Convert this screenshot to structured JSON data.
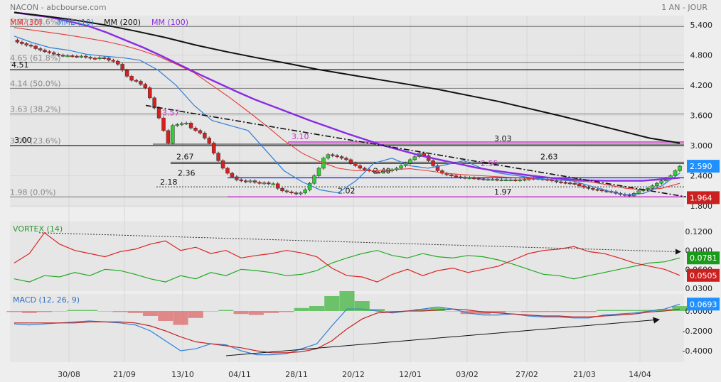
{
  "header": {
    "title": "NACON - abcbourse.com",
    "period": "1 AN - JOUR"
  },
  "legend": [
    {
      "label": "MM (30)",
      "color": "#e53935"
    },
    {
      "label": "MME (10)",
      "color": "#2f7fd6"
    },
    {
      "label": "MM (200)",
      "color": "#111111"
    },
    {
      "label": "MM (100)",
      "color": "#8a2be2"
    }
  ],
  "colors": {
    "background": "#eeeeee",
    "candle_up": "#33cc33",
    "candle_down": "#d62020",
    "fib_line": "#777777",
    "magenta": "#cc33cc",
    "blue_level": "#2b3fd6",
    "price_badge": "#1e90ff",
    "vortex_plus": "#22aa22",
    "vortex_minus": "#dd2222",
    "macd_line": "#2f7fd6",
    "signal_line": "#c62020",
    "hist_pos": "#55bb55",
    "hist_neg": "#dd7777"
  },
  "fibonacci": [
    {
      "label": "5.37 (78.6%)",
      "value": 5.37
    },
    {
      "label": "4.65 (61.8%)",
      "value": 4.65
    },
    {
      "label": "4.14 (50.0%)",
      "value": 4.14
    },
    {
      "label": "3.63 (38.2%)",
      "value": 3.63
    },
    {
      "label": "3.00 (23.6%)",
      "value": 3.0
    },
    {
      "label": "1.98 (0.0%)",
      "value": 1.98
    }
  ],
  "level_labels": [
    "4.51",
    "3.00",
    "3.10",
    "3.03",
    "2.67",
    "2.63",
    "2.36",
    "2.18",
    "2.40",
    "2.55",
    "2.02",
    "1.97",
    "3.57"
  ],
  "chart_data": [
    {
      "type": "candlestick",
      "title": "NACON",
      "x_tick_labels": [
        "30/08",
        "21/09",
        "13/10",
        "04/11",
        "28/11",
        "20/12",
        "12/01",
        "03/02",
        "27/02",
        "21/03",
        "14/04"
      ],
      "y_tick_labels": [
        "5.400",
        "4.800",
        "4.200",
        "3.600",
        "3.000",
        "2.400",
        "1.800"
      ],
      "ylim": [
        1.8,
        5.7
      ],
      "last_price": "2.590",
      "support_badge": "1.964",
      "closes": [
        5.1,
        5.06,
        5.03,
        5.0,
        4.98,
        4.93,
        4.9,
        4.87,
        4.85,
        4.82,
        4.8,
        4.79,
        4.79,
        4.78,
        4.77,
        4.78,
        4.76,
        4.74,
        4.73,
        4.75,
        4.74,
        4.7,
        4.68,
        4.62,
        4.5,
        4.38,
        4.3,
        4.28,
        4.22,
        4.15,
        3.95,
        3.75,
        3.55,
        3.3,
        3.05,
        3.4,
        3.42,
        3.44,
        3.45,
        3.35,
        3.3,
        3.25,
        3.15,
        3.05,
        2.85,
        2.7,
        2.55,
        2.45,
        2.38,
        2.32,
        2.3,
        2.28,
        2.3,
        2.27,
        2.25,
        2.26,
        2.24,
        2.24,
        2.15,
        2.1,
        2.08,
        2.06,
        2.04,
        2.06,
        2.12,
        2.25,
        2.4,
        2.55,
        2.75,
        2.82,
        2.8,
        2.78,
        2.75,
        2.72,
        2.65,
        2.6,
        2.55,
        2.52,
        2.5,
        2.48,
        2.47,
        2.48,
        2.5,
        2.52,
        2.55,
        2.6,
        2.65,
        2.72,
        2.78,
        2.85,
        2.8,
        2.7,
        2.6,
        2.5,
        2.45,
        2.42,
        2.4,
        2.38,
        2.37,
        2.36,
        2.36,
        2.35,
        2.34,
        2.33,
        2.33,
        2.33,
        2.32,
        2.32,
        2.32,
        2.32,
        2.31,
        2.32,
        2.33,
        2.34,
        2.35,
        2.34,
        2.33,
        2.32,
        2.3,
        2.28,
        2.27,
        2.26,
        2.25,
        2.24,
        2.2,
        2.17,
        2.15,
        2.13,
        2.12,
        2.1,
        2.09,
        2.08,
        2.05,
        2.03,
        2.02,
        2.0,
        2.05,
        2.1,
        2.12,
        2.15,
        2.2,
        2.25,
        2.3,
        2.35,
        2.4,
        2.5,
        2.59
      ],
      "series": [
        {
          "name": "MM (30)",
          "values": [
            5.35,
            5.3,
            5.25,
            5.2,
            5.14,
            5.08,
            5.0,
            4.9,
            4.78,
            4.62,
            4.45,
            4.2,
            3.95,
            3.68,
            3.4,
            3.1,
            2.85,
            2.68,
            2.55,
            2.5,
            2.5,
            2.52,
            2.54,
            2.5,
            2.45,
            2.42,
            2.4,
            2.38,
            2.36,
            2.34,
            2.32,
            2.3,
            2.28,
            2.22,
            2.15,
            2.12,
            2.15,
            2.25
          ]
        },
        {
          "name": "MME (10)",
          "values": [
            5.18,
            5.05,
            4.95,
            4.9,
            4.82,
            4.78,
            4.75,
            4.7,
            4.5,
            4.2,
            3.8,
            3.5,
            3.4,
            3.3,
            2.9,
            2.5,
            2.28,
            2.12,
            2.06,
            2.3,
            2.65,
            2.75,
            2.6,
            2.55,
            2.62,
            2.7,
            2.55,
            2.45,
            2.4,
            2.35,
            2.32,
            2.3,
            2.2,
            2.1,
            2.02,
            2.05,
            2.2,
            2.45
          ]
        },
        {
          "name": "MM (100)",
          "values": [
            5.65,
            5.6,
            5.55,
            5.47,
            5.38,
            5.25,
            5.1,
            4.95,
            4.78,
            4.6,
            4.42,
            4.25,
            4.08,
            3.92,
            3.78,
            3.64,
            3.5,
            3.37,
            3.24,
            3.12,
            3.0,
            2.9,
            2.8,
            2.72,
            2.64,
            2.56,
            2.5,
            2.45,
            2.4,
            2.36,
            2.33,
            2.31,
            2.3,
            2.3,
            2.3,
            2.33,
            2.36
          ]
        },
        {
          "name": "MM (200)",
          "values": [
            5.65,
            5.58,
            5.5,
            5.4,
            5.28,
            5.15,
            5.0,
            4.87,
            4.75,
            4.64,
            4.52,
            4.42,
            4.32,
            4.22,
            4.12,
            4.0,
            3.88,
            3.74,
            3.6,
            3.45,
            3.3,
            3.15,
            3.05
          ]
        }
      ]
    },
    {
      "type": "line",
      "title": "VORTEX (14)",
      "y_tick_labels": [
        "0.1200",
        "0.0900",
        "0.0600",
        "0.0300"
      ],
      "ylim": [
        0.03,
        0.12
      ],
      "badges": [
        "0.0781",
        "0.0505"
      ],
      "series": [
        {
          "name": "VI+",
          "values": [
            0.045,
            0.04,
            0.05,
            0.048,
            0.055,
            0.05,
            0.06,
            0.058,
            0.052,
            0.045,
            0.04,
            0.05,
            0.045,
            0.055,
            0.05,
            0.06,
            0.058,
            0.055,
            0.05,
            0.052,
            0.058,
            0.07,
            0.078,
            0.085,
            0.09,
            0.082,
            0.078,
            0.085,
            0.08,
            0.078,
            0.082,
            0.08,
            0.075,
            0.068,
            0.06,
            0.052,
            0.05,
            0.045,
            0.05,
            0.055,
            0.06,
            0.065,
            0.07,
            0.072,
            0.078
          ]
        },
        {
          "name": "VI-",
          "values": [
            0.07,
            0.085,
            0.118,
            0.1,
            0.09,
            0.085,
            0.08,
            0.088,
            0.092,
            0.1,
            0.105,
            0.09,
            0.095,
            0.085,
            0.09,
            0.078,
            0.082,
            0.085,
            0.09,
            0.086,
            0.08,
            0.062,
            0.05,
            0.048,
            0.04,
            0.052,
            0.06,
            0.05,
            0.058,
            0.062,
            0.055,
            0.06,
            0.065,
            0.075,
            0.085,
            0.09,
            0.092,
            0.096,
            0.088,
            0.085,
            0.078,
            0.07,
            0.065,
            0.06,
            0.0505
          ]
        }
      ]
    },
    {
      "type": "line",
      "title": "MACD (12, 26, 9)",
      "y_tick_labels": [
        "0.0000",
        "-0.2000",
        "-0.4000"
      ],
      "ylim": [
        -0.48,
        0.1
      ],
      "badges": [
        "0.0693"
      ],
      "series": [
        {
          "name": "MACD",
          "values": [
            -0.13,
            -0.14,
            -0.13,
            -0.12,
            -0.11,
            -0.1,
            -0.11,
            -0.12,
            -0.14,
            -0.2,
            -0.3,
            -0.4,
            -0.38,
            -0.33,
            -0.34,
            -0.4,
            -0.44,
            -0.44,
            -0.43,
            -0.38,
            -0.33,
            -0.15,
            0.02,
            0.02,
            0.0,
            -0.02,
            0.0,
            0.02,
            0.04,
            0.02,
            -0.02,
            -0.04,
            -0.04,
            -0.03,
            -0.05,
            -0.06,
            -0.06,
            -0.07,
            -0.07,
            -0.04,
            -0.03,
            -0.02,
            0.0,
            0.02,
            0.0693
          ]
        },
        {
          "name": "Signal",
          "values": [
            -0.12,
            -0.12,
            -0.12,
            -0.12,
            -0.12,
            -0.11,
            -0.11,
            -0.11,
            -0.12,
            -0.15,
            -0.2,
            -0.26,
            -0.31,
            -0.33,
            -0.35,
            -0.37,
            -0.4,
            -0.42,
            -0.42,
            -0.41,
            -0.38,
            -0.3,
            -0.18,
            -0.08,
            -0.02,
            -0.01,
            0.0,
            0.0,
            0.01,
            0.02,
            0.01,
            -0.01,
            -0.02,
            -0.03,
            -0.04,
            -0.05,
            -0.05,
            -0.06,
            -0.06,
            -0.05,
            -0.04,
            -0.03,
            -0.01,
            0.0,
            0.02
          ]
        }
      ]
    }
  ]
}
